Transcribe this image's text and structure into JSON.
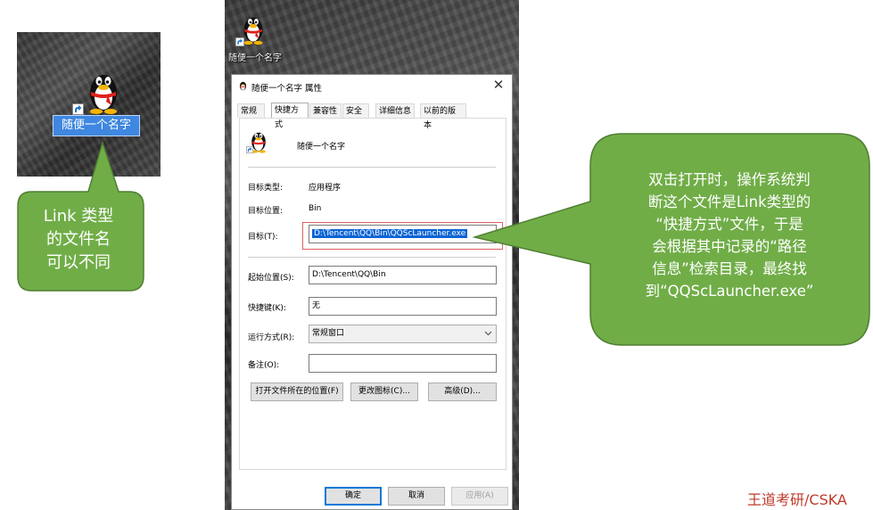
{
  "thumbnail": {
    "icon_label": "随便一个名字"
  },
  "desktop": {
    "icon_label": "随便一个名字"
  },
  "dialog": {
    "title": "随便一个名字 属性",
    "close_glyph": "✕",
    "tabs": [
      "常规",
      "快捷方式",
      "兼容性",
      "安全",
      "详细信息",
      "以前的版本"
    ],
    "active_tab": "快捷方式",
    "shortcut_name": "随便一个名字",
    "target_type_label": "目标类型:",
    "target_type_value": "应用程序",
    "target_location_label": "目标位置:",
    "target_location_value": "Bin",
    "target_label": "目标(T):",
    "target_value": "D:\\Tencent\\QQ\\Bin\\QQScLauncher.exe",
    "start_in_label": "起始位置(S):",
    "start_in_value": "D:\\Tencent\\QQ\\Bin",
    "shortcut_key_label": "快捷键(K):",
    "shortcut_key_value": "无",
    "run_label": "运行方式(R):",
    "run_value": "常规窗口",
    "comment_label": "备注(O):",
    "comment_value": "",
    "open_location_button": "打开文件所在的位置(F)",
    "change_icon_button": "更改图标(C)...",
    "advanced_button": "高级(D)...",
    "ok_button": "确定",
    "cancel_button": "取消",
    "apply_button": "应用(A)"
  },
  "callout_left": {
    "lines": [
      "Link 类型",
      "的文件名",
      "可以不同"
    ]
  },
  "callout_right": {
    "lines": [
      "双击打开时，操作系统判",
      "断这个文件是Link类型的",
      "“快捷方式”文件，于是",
      "会根据其中记录的“路径",
      "信息”检索目录，最终找",
      "到“QQScLauncher.exe”"
    ]
  },
  "watermark": "王道考研/CSKA",
  "colors": {
    "callout_fill": "#70ad47",
    "callout_border": "#507e32",
    "selection": "#0a64d4",
    "highlight_box": "#e06060",
    "watermark": "#c0392b"
  }
}
